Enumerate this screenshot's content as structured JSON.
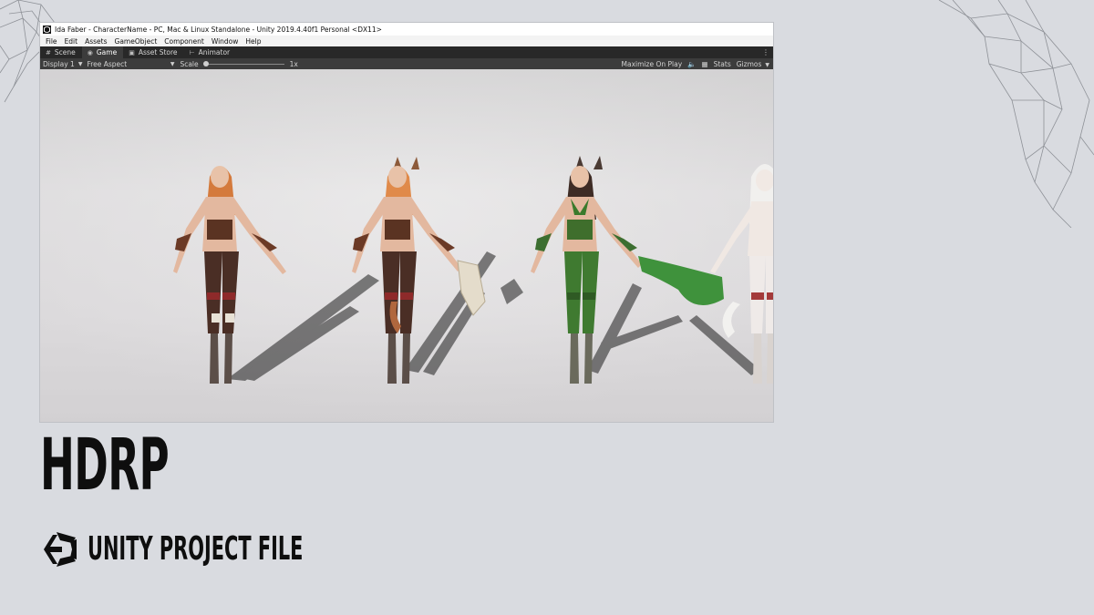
{
  "window": {
    "title": "Ida Faber - CharacterName - PC, Mac & Linux Standalone - Unity 2019.4.40f1 Personal <DX11>"
  },
  "menu": [
    "File",
    "Edit",
    "Assets",
    "GameObject",
    "Component",
    "Window",
    "Help"
  ],
  "tabs": [
    {
      "label": "Scene",
      "icon": "grid-icon",
      "active": false
    },
    {
      "label": "Game",
      "icon": "gamepad-icon",
      "active": true
    },
    {
      "label": "Asset Store",
      "icon": "store-bag-icon",
      "active": false
    },
    {
      "label": "Animator",
      "icon": "animator-icon",
      "active": false
    }
  ],
  "toolbar": {
    "display": "Display 1",
    "aspect": "Free Aspect",
    "scale_label": "Scale",
    "scale_value": "1x",
    "maximize": "Maximize On Play",
    "stats": "Stats",
    "gizmos": "Gizmos"
  },
  "overlay": {
    "heading": "HDRP",
    "subheading": "UNITY PROJECT FILE"
  },
  "colors": {
    "background": "#d9dbe0",
    "tab_bar": "#282828",
    "toolbar": "#3c3c3c",
    "text_dark": "#0e0e0e"
  }
}
